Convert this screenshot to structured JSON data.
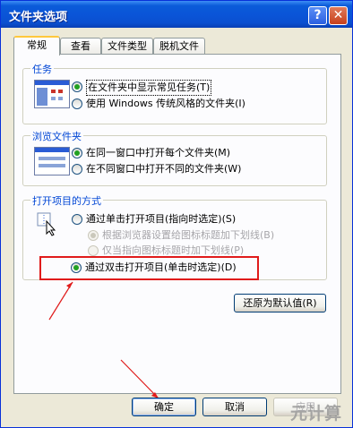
{
  "window": {
    "title": "文件夹选项",
    "help_label": "?",
    "close_label": "✕"
  },
  "tabs": [
    {
      "label": "常规",
      "active": true
    },
    {
      "label": "查看",
      "active": false
    },
    {
      "label": "文件类型",
      "active": false
    },
    {
      "label": "脱机文件",
      "active": false
    }
  ],
  "groups": {
    "tasks": {
      "title": "任务",
      "options": [
        {
          "label": "在文件夹中显示常见任务(T)",
          "checked": true
        },
        {
          "label": "使用 Windows 传统风格的文件夹(I)",
          "checked": false
        }
      ]
    },
    "browse": {
      "title": "浏览文件夹",
      "options": [
        {
          "label": "在同一窗口中打开每个文件夹(M)",
          "checked": true
        },
        {
          "label": "在不同窗口中打开不同的文件夹(W)",
          "checked": false
        }
      ]
    },
    "open_items": {
      "title": "打开项目的方式",
      "options": [
        {
          "label": "通过单击打开项目(指向时选定)(S)",
          "checked": false
        },
        {
          "label": "根据浏览器设置给图标标题加下划线(B)",
          "checked": true,
          "disabled": true
        },
        {
          "label": "仅当指向图标标题时加下划线(P)",
          "checked": false,
          "disabled": true
        },
        {
          "label": "通过双击打开项目(单击时选定)(D)",
          "checked": true
        }
      ]
    }
  },
  "buttons": {
    "restore_defaults": "还原为默认值(R)",
    "ok": "确定",
    "cancel": "取消",
    "apply": "应用"
  },
  "watermark": "元计算",
  "colors": {
    "titlebar": "#0a55d8",
    "annotation": "#e01b1b",
    "group_title": "#0046d5"
  }
}
